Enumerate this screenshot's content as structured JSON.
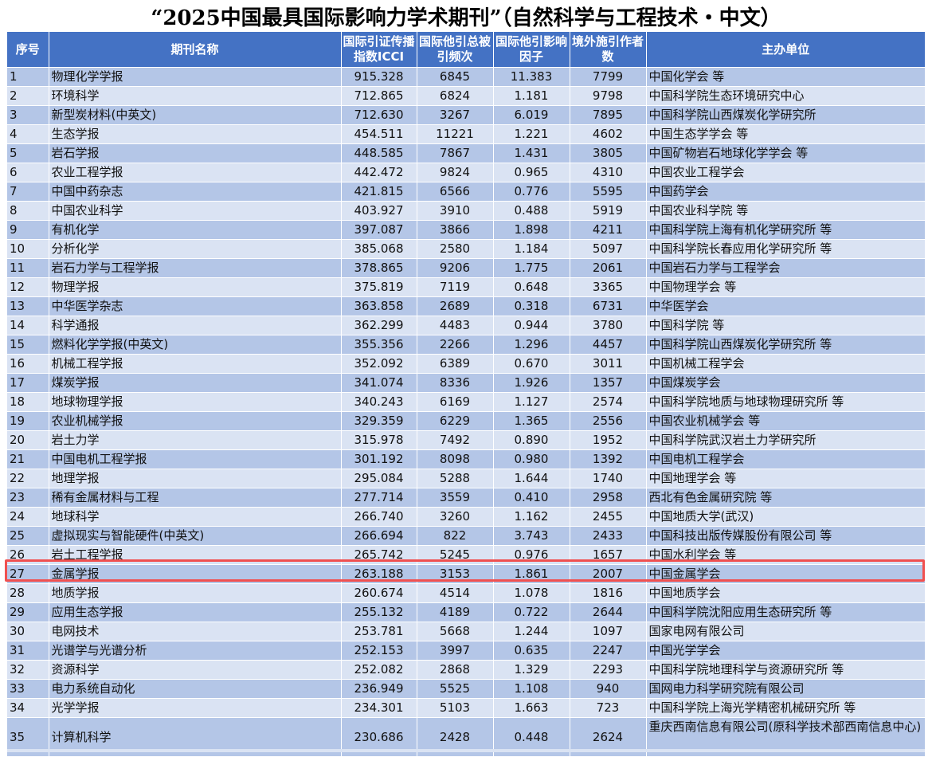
{
  "title": "“2025中国最具国际影响力学术期刊”（自然科学与工程技术・中文）",
  "header": {
    "no": "序号",
    "name": "期刊名称",
    "icci": "国际引证传播指数ICCI",
    "cites": "国际他引总被引频次",
    "impact": "国际他引影响因子",
    "authors": "境外施引作者数",
    "org": "主办单位"
  },
  "highlighted_no": "27",
  "rows": [
    {
      "no": "1",
      "name": "物理化学学报",
      "icci": "915.328",
      "cites": "6845",
      "impact": "11.383",
      "authors": "7799",
      "org": "中国化学会 等"
    },
    {
      "no": "2",
      "name": "环境科学",
      "icci": "712.865",
      "cites": "6824",
      "impact": "1.181",
      "authors": "9798",
      "org": "中国科学院生态环境研究中心"
    },
    {
      "no": "3",
      "name": "新型炭材料(中英文)",
      "icci": "712.630",
      "cites": "3267",
      "impact": "6.019",
      "authors": "7895",
      "org": "中国科学院山西煤炭化学研究所"
    },
    {
      "no": "4",
      "name": "生态学报",
      "icci": "454.511",
      "cites": "11221",
      "impact": "1.221",
      "authors": "4602",
      "org": "中国生态学学会 等"
    },
    {
      "no": "5",
      "name": "岩石学报",
      "icci": "448.585",
      "cites": "7867",
      "impact": "1.431",
      "authors": "3805",
      "org": "中国矿物岩石地球化学学会 等"
    },
    {
      "no": "6",
      "name": "农业工程学报",
      "icci": "442.472",
      "cites": "9824",
      "impact": "0.965",
      "authors": "4310",
      "org": "中国农业工程学会"
    },
    {
      "no": "7",
      "name": "中国中药杂志",
      "icci": "421.815",
      "cites": "6566",
      "impact": "0.776",
      "authors": "5595",
      "org": "中国药学会"
    },
    {
      "no": "8",
      "name": "中国农业科学",
      "icci": "403.927",
      "cites": "3910",
      "impact": "0.488",
      "authors": "5919",
      "org": "中国农业科学院 等"
    },
    {
      "no": "9",
      "name": "有机化学",
      "icci": "397.087",
      "cites": "3866",
      "impact": "1.898",
      "authors": "4211",
      "org": "中国科学院上海有机化学研究所 等"
    },
    {
      "no": "10",
      "name": "分析化学",
      "icci": "385.068",
      "cites": "2580",
      "impact": "1.184",
      "authors": "5097",
      "org": "中国科学院长春应用化学研究所 等"
    },
    {
      "no": "11",
      "name": "岩石力学与工程学报",
      "icci": "378.865",
      "cites": "9206",
      "impact": "1.775",
      "authors": "2061",
      "org": "中国岩石力学与工程学会"
    },
    {
      "no": "12",
      "name": "物理学报",
      "icci": "375.819",
      "cites": "7119",
      "impact": "0.648",
      "authors": "3365",
      "org": "中国物理学会 等"
    },
    {
      "no": "13",
      "name": "中华医学杂志",
      "icci": "363.858",
      "cites": "2689",
      "impact": "0.318",
      "authors": "6731",
      "org": "中华医学会"
    },
    {
      "no": "14",
      "name": "科学通报",
      "icci": "362.299",
      "cites": "4483",
      "impact": "0.944",
      "authors": "3780",
      "org": "中国科学院 等"
    },
    {
      "no": "15",
      "name": "燃料化学学报(中英文)",
      "icci": "355.356",
      "cites": "2266",
      "impact": "1.296",
      "authors": "4457",
      "org": "中国科学院山西煤炭化学研究所 等"
    },
    {
      "no": "16",
      "name": "机械工程学报",
      "icci": "352.092",
      "cites": "6389",
      "impact": "0.670",
      "authors": "3011",
      "org": "中国机械工程学会"
    },
    {
      "no": "17",
      "name": "煤炭学报",
      "icci": "341.074",
      "cites": "8336",
      "impact": "1.926",
      "authors": "1357",
      "org": "中国煤炭学会"
    },
    {
      "no": "18",
      "name": "地球物理学报",
      "icci": "340.243",
      "cites": "6169",
      "impact": "1.127",
      "authors": "2574",
      "org": "中国科学院地质与地球物理研究所 等"
    },
    {
      "no": "19",
      "name": "农业机械学报",
      "icci": "329.359",
      "cites": "6229",
      "impact": "1.365",
      "authors": "2556",
      "org": "中国农业机械学会 等"
    },
    {
      "no": "20",
      "name": "岩土力学",
      "icci": "315.978",
      "cites": "7492",
      "impact": "0.890",
      "authors": "1952",
      "org": "中国科学院武汉岩土力学研究所"
    },
    {
      "no": "21",
      "name": "中国电机工程学报",
      "icci": "301.192",
      "cites": "8098",
      "impact": "0.980",
      "authors": "1392",
      "org": "中国电机工程学会"
    },
    {
      "no": "22",
      "name": "地理学报",
      "icci": "295.084",
      "cites": "5288",
      "impact": "1.644",
      "authors": "1740",
      "org": "中国地理学会 等"
    },
    {
      "no": "23",
      "name": "稀有金属材料与工程",
      "icci": "277.714",
      "cites": "3559",
      "impact": "0.410",
      "authors": "2958",
      "org": "西北有色金属研究院 等"
    },
    {
      "no": "24",
      "name": "地球科学",
      "icci": "266.740",
      "cites": "3260",
      "impact": "1.162",
      "authors": "2455",
      "org": "中国地质大学(武汉)"
    },
    {
      "no": "25",
      "name": "虚拟现实与智能硬件(中英文)",
      "icci": "266.694",
      "cites": "822",
      "impact": "3.743",
      "authors": "2433",
      "org": "中国科技出版传媒股份有限公司 等"
    },
    {
      "no": "26",
      "name": "岩土工程学报",
      "icci": "265.742",
      "cites": "5245",
      "impact": "0.976",
      "authors": "1657",
      "org": "中国水利学会 等"
    },
    {
      "no": "27",
      "name": "金属学报",
      "icci": "263.188",
      "cites": "3153",
      "impact": "1.861",
      "authors": "2007",
      "org": "中国金属学会"
    },
    {
      "no": "28",
      "name": "地质学报",
      "icci": "260.674",
      "cites": "4514",
      "impact": "1.078",
      "authors": "1816",
      "org": "中国地质学会"
    },
    {
      "no": "29",
      "name": "应用生态学报",
      "icci": "255.132",
      "cites": "4189",
      "impact": "0.722",
      "authors": "2644",
      "org": "中国科学院沈阳应用生态研究所 等"
    },
    {
      "no": "30",
      "name": "电网技术",
      "icci": "253.781",
      "cites": "5668",
      "impact": "1.244",
      "authors": "1097",
      "org": "国家电网有限公司"
    },
    {
      "no": "31",
      "name": "光谱学与光谱分析",
      "icci": "252.153",
      "cites": "3997",
      "impact": "0.635",
      "authors": "2247",
      "org": "中国光学学会"
    },
    {
      "no": "32",
      "name": "资源科学",
      "icci": "252.082",
      "cites": "2868",
      "impact": "1.329",
      "authors": "2293",
      "org": "中国科学院地理科学与资源研究所 等"
    },
    {
      "no": "33",
      "name": "电力系统自动化",
      "icci": "236.949",
      "cites": "5525",
      "impact": "1.108",
      "authors": "940",
      "org": "国网电力科学研究院有限公司"
    },
    {
      "no": "34",
      "name": "光学学报",
      "icci": "234.301",
      "cites": "5103",
      "impact": "1.663",
      "authors": "723",
      "org": "中国科学院上海光学精密机械研究所 等"
    },
    {
      "no": "35",
      "name": "计算机科学",
      "icci": "230.686",
      "cites": "2428",
      "impact": "0.448",
      "authors": "2624",
      "org": "重庆西南信息有限公司(原科学技术部西南信息中心)"
    }
  ]
}
